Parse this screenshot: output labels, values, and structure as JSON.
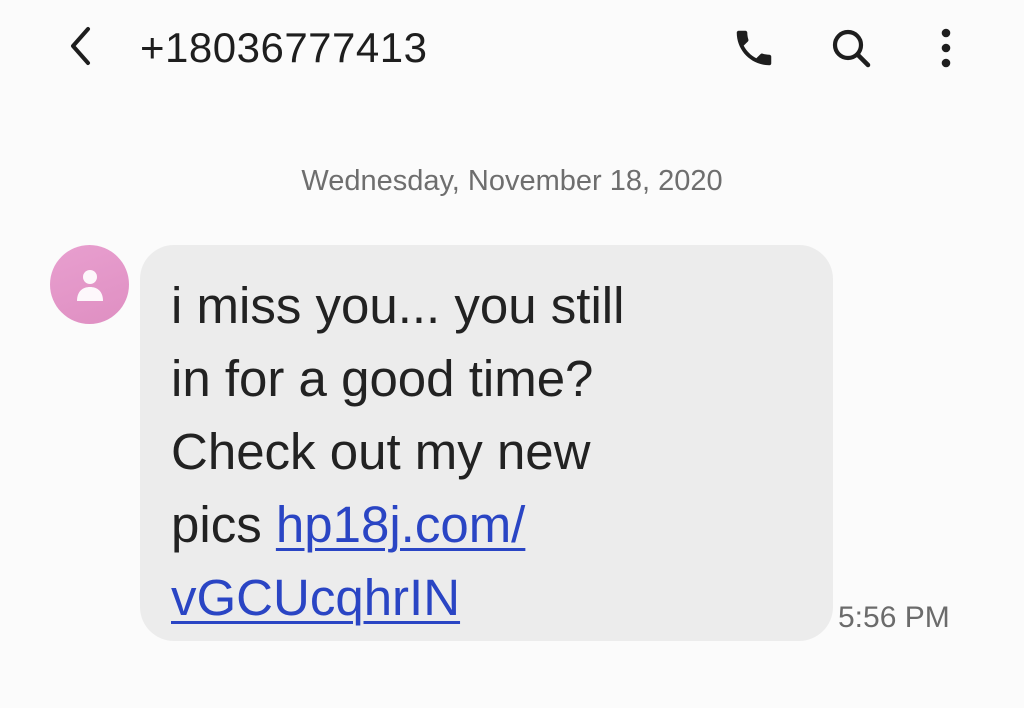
{
  "header": {
    "contact_number": "+18036777413",
    "back_icon": "chevron-left-icon",
    "call_icon": "phone-icon",
    "search_icon": "search-icon",
    "more_icon": "more-vertical-icon"
  },
  "conversation": {
    "date_separator": "Wednesday, November 18, 2020",
    "messages": [
      {
        "sender_avatar_icon": "person-icon",
        "avatar_color": "#e59bcb",
        "text_lines": [
          "i miss you... you still",
          "in for a good time?",
          "Check out my new",
          "pics "
        ],
        "link_lines": [
          "hp18j.com/",
          "vGCUcqhrIN"
        ],
        "link_color": "#2a45c4",
        "time": "5:56 PM"
      }
    ]
  },
  "colors": {
    "background": "#fbfbfb",
    "bubble": "#ececec",
    "text": "#222222",
    "secondary_text": "#6e6e6e"
  }
}
